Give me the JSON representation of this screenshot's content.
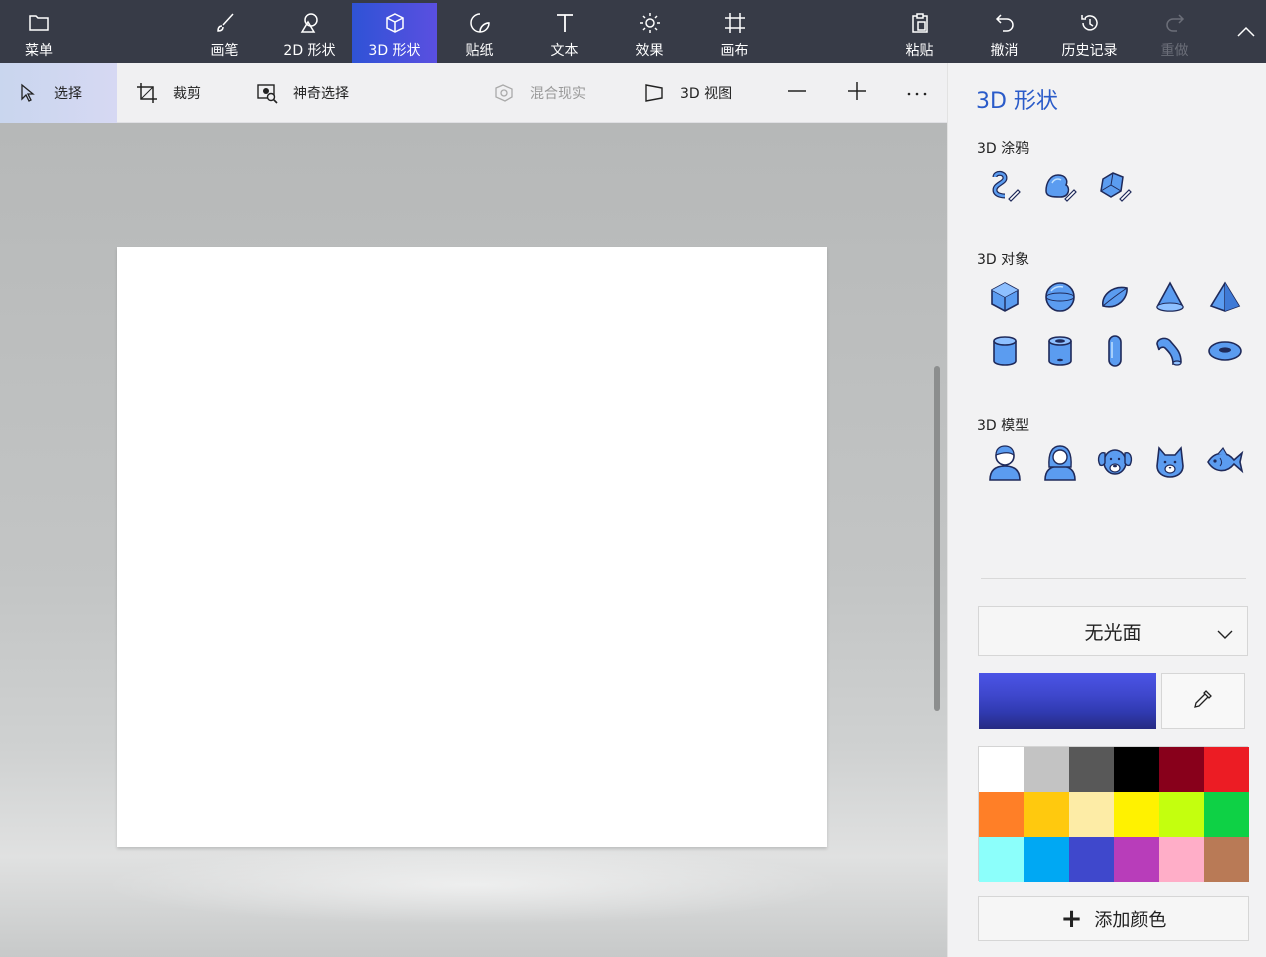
{
  "topbar": {
    "menu": {
      "label": "菜单",
      "icon": "folder-icon"
    },
    "tools": [
      {
        "label": "画笔",
        "icon": "brush-icon"
      },
      {
        "label": "2D 形状",
        "icon": "shapes-2d-icon"
      },
      {
        "label": "3D 形状",
        "icon": "cube-icon"
      },
      {
        "label": "贴纸",
        "icon": "sticker-icon"
      },
      {
        "label": "文本",
        "icon": "text-icon"
      },
      {
        "label": "效果",
        "icon": "sun-icon"
      },
      {
        "label": "画布",
        "icon": "canvas-icon"
      }
    ],
    "active_tool": "3D 形状",
    "actions": [
      {
        "label": "粘贴",
        "icon": "paste-icon"
      },
      {
        "label": "撤消",
        "icon": "undo-icon"
      },
      {
        "label": "历史记录",
        "icon": "history-icon"
      },
      {
        "label": "重做",
        "icon": "redo-icon",
        "disabled": true
      }
    ],
    "collapse_icon": "chevron-up-icon"
  },
  "subbar": {
    "select": "选择",
    "crop": "裁剪",
    "magic_select": "神奇选择",
    "mixed_reality": "混合现实",
    "view_3d": "3D 视图",
    "zoom_out_icon": "minus-icon",
    "zoom_in_icon": "plus-icon",
    "more_icon": "ellipsis-icon"
  },
  "panel": {
    "title": "3D 形状",
    "doodle_label": "3D 涂鸦",
    "doodles": [
      "tube-doodle-icon",
      "soft-doodle-icon",
      "sharp-doodle-icon"
    ],
    "objects_label": "3D 对象",
    "objects": [
      "cube-icon",
      "sphere-icon",
      "hemisphere-icon",
      "cone-icon",
      "pyramid-icon",
      "cylinder-icon",
      "tube-icon",
      "capsule-icon",
      "curved-tube-icon",
      "donut-icon"
    ],
    "models_label": "3D 模型",
    "models": [
      "man-icon",
      "woman-icon",
      "dog-icon",
      "cat-icon",
      "fish-icon"
    ],
    "finish": "无光面",
    "current_color": "#3e47cc",
    "palette": [
      "#ffffff",
      "#c3c3c3",
      "#585858",
      "#000000",
      "#88001b",
      "#ec1c24",
      "#ff7f27",
      "#ffc90e",
      "#fdeca6",
      "#fff200",
      "#c4ff0e",
      "#0ed145",
      "#8cfffb",
      "#00a8f3",
      "#3f48cc",
      "#b83dba",
      "#ffaec8",
      "#b97a56"
    ],
    "add_color": "添加颜色"
  }
}
